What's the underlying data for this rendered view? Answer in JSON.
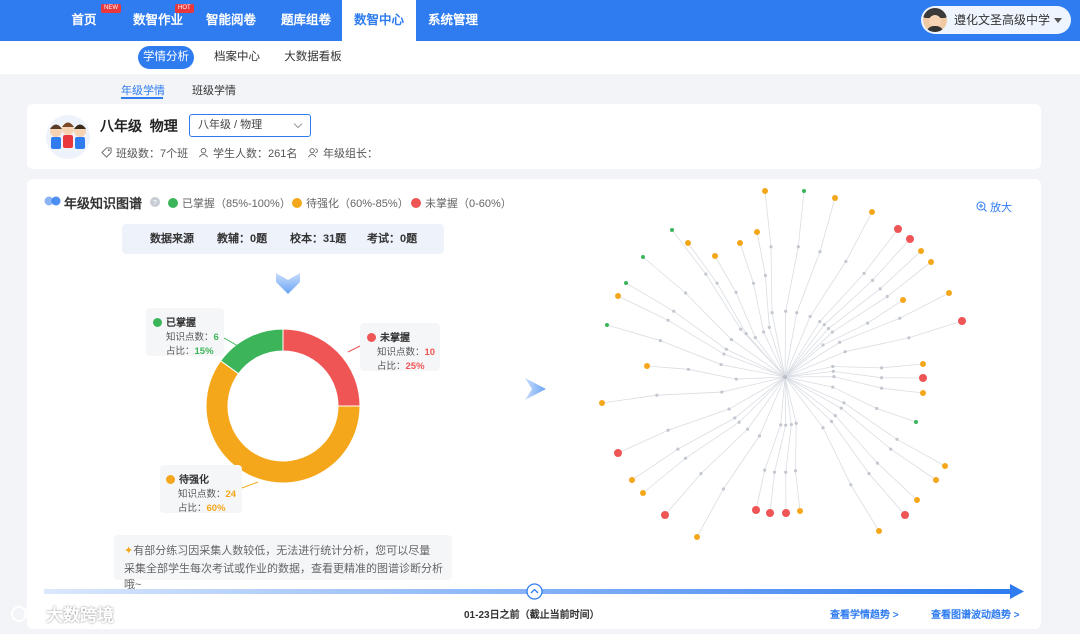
{
  "nav": {
    "items": [
      {
        "label": "首页",
        "badge": "NEW"
      },
      {
        "label": "数智作业",
        "badge": "HOT"
      },
      {
        "label": "智能阅卷",
        "badge": ""
      },
      {
        "label": "题库组卷",
        "badge": ""
      },
      {
        "label": "数智中心",
        "badge": ""
      },
      {
        "label": "系统管理",
        "badge": ""
      }
    ],
    "active": "数智中心",
    "user": "遵化文圣高级中学"
  },
  "subnav": {
    "items": [
      "学情分析",
      "档案中心",
      "大数据看板"
    ],
    "active": "学情分析"
  },
  "tabs": {
    "items": [
      "年级学情",
      "班级学情"
    ],
    "active": "年级学情"
  },
  "grade": {
    "title": "八年级  物理",
    "select_value": "八年级 / 物理",
    "class_count": "班级数：7个班",
    "student_count": "学生人数：261名",
    "leader": "年级组长："
  },
  "knowledge": {
    "title": "年级知识图谱",
    "legend": [
      {
        "label": "已掌握（85%-100%）",
        "color": "#3cb55a"
      },
      {
        "label": "待强化（60%-85%）",
        "color": "#f5a71b"
      },
      {
        "label": "未掌握（0-60%）",
        "color": "#f05555"
      }
    ],
    "zoom": "放大",
    "data_source": {
      "label": "数据来源",
      "tutoring": "教辅：0题",
      "school": "校本：31题",
      "exam": "考试：0题"
    }
  },
  "chart_data": {
    "type": "pie",
    "categories": [
      "未掌握",
      "待强化",
      "已掌握"
    ],
    "values": [
      10,
      24,
      6
    ],
    "percents": [
      "25%",
      "60%",
      "15%"
    ],
    "colors": [
      "#f05555",
      "#f5a71b",
      "#3cb55a"
    ],
    "donut": true,
    "callouts": [
      {
        "title": "已掌握",
        "count_label": "知识点数：",
        "count": "6",
        "pct_label": "占比：",
        "pct": "15%",
        "color": "#3cb55a"
      },
      {
        "title": "未掌握",
        "count_label": "知识点数：",
        "count": "10",
        "pct_label": "占比：",
        "pct": "25%",
        "color": "#f05555"
      },
      {
        "title": "待强化",
        "count_label": "知识点数：",
        "count": "24",
        "pct_label": "占比：",
        "pct": "60%",
        "color": "#f5a71b"
      }
    ]
  },
  "notice": {
    "line1": "有部分练习因采集人数较低，无法进行统计分析，您可以尽量",
    "line2": "采集全部学生每次考试或作业的数据，查看更精准的图谱诊断分析哦~"
  },
  "timeline": {
    "label": "01-23日之前（截止当前时间）",
    "link_trend": "查看学情趋势 >",
    "link_wave": "查看图谱波动趋势 >"
  },
  "watermark": "大数跨境"
}
